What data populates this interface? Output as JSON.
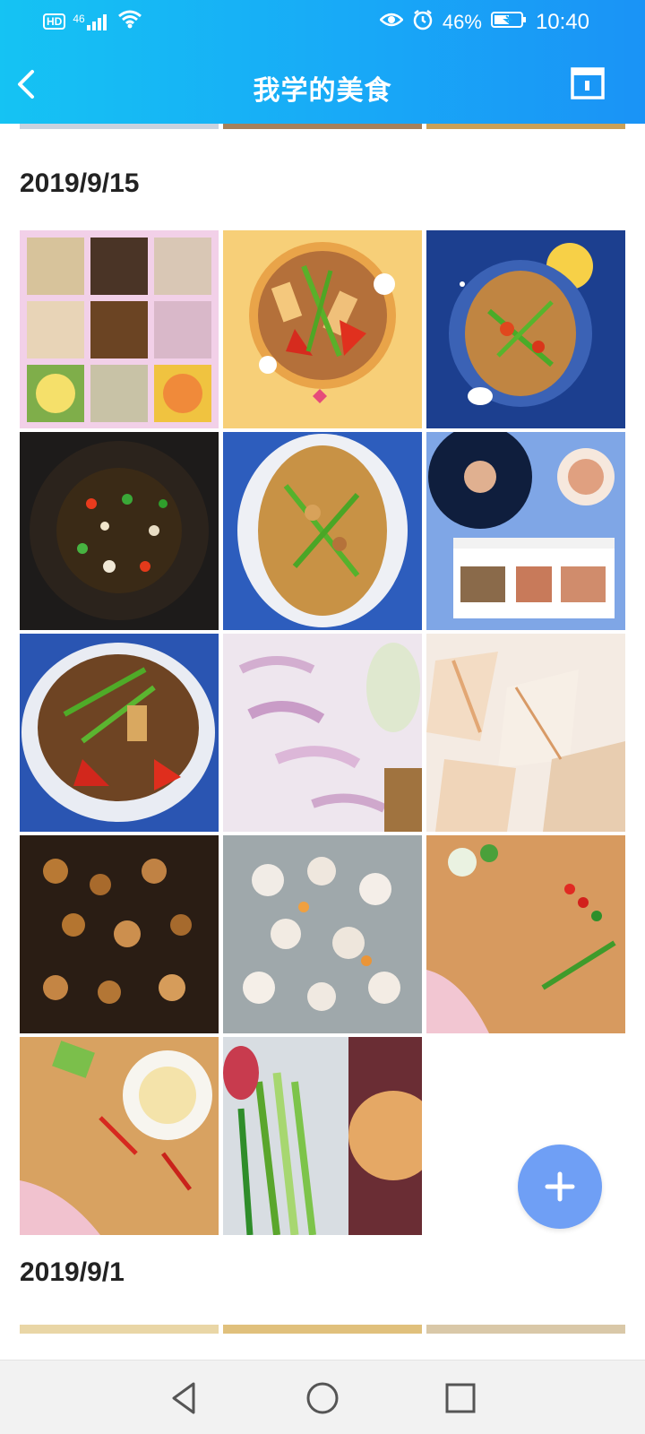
{
  "status_bar": {
    "hd": "HD",
    "network": "46",
    "battery": "46%",
    "time": "10:40"
  },
  "app_bar": {
    "title": "我学的美食"
  },
  "sections": [
    {
      "date": "2019/9/15",
      "photo_count": 14
    },
    {
      "date": "2019/9/1"
    }
  ],
  "icons": {
    "back": "back-arrow-icon",
    "calendar": "calendar-icon",
    "fab": "plus-icon",
    "nav_back": "triangle-back-icon",
    "nav_home": "circle-home-icon",
    "nav_recent": "square-recent-icon"
  },
  "colors": {
    "header_start": "#15c3f3",
    "header_end": "#1a93f6",
    "fab": "#6f9ff5"
  }
}
